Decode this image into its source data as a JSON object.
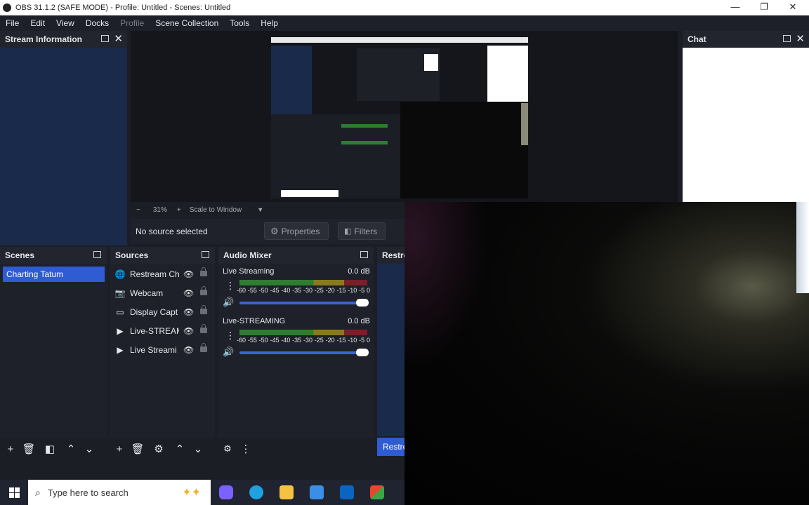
{
  "window": {
    "title": "OBS 31.1.2 (SAFE MODE) - Profile: Untitled - Scenes: Untitled",
    "controls": [
      "—",
      "❐",
      "✕"
    ]
  },
  "menu": [
    "File",
    "Edit",
    "View",
    "Docks",
    "Profile",
    "Scene Collection",
    "Tools",
    "Help"
  ],
  "docks": {
    "stream_information": "Stream Information",
    "chat": "Chat",
    "scenes": "Scenes",
    "sources": "Sources",
    "audio_mixer": "Audio Mixer",
    "restream": "Restre"
  },
  "preview": {
    "zoom": "31%",
    "scale_mode": "Scale to Window",
    "no_source": "No source selected",
    "properties": "Properties",
    "filters": "Filters"
  },
  "scenes": [
    "Charting Tatum"
  ],
  "sources": [
    {
      "name": "Restream Ch",
      "icon": "globe-icon"
    },
    {
      "name": "Webcam",
      "icon": "camera-icon"
    },
    {
      "name": "Display Capt",
      "icon": "monitor-icon"
    },
    {
      "name": "Live-STREAM",
      "icon": "play-icon"
    },
    {
      "name": "Live Streami",
      "icon": "play-icon"
    }
  ],
  "mixer": [
    {
      "name": "Live Streaming",
      "db": "0.0 dB",
      "volume": 1.0
    },
    {
      "name": "Live-STREAMING",
      "db": "0.0 dB",
      "volume": 1.0
    }
  ],
  "meter_scale": [
    "-60",
    "-55",
    "-50",
    "-45",
    "-40",
    "-35",
    "-30",
    "-25",
    "-20",
    "-15",
    "-10",
    "-5",
    "0"
  ],
  "restream_button": "Restre",
  "taskbar": {
    "search_placeholder": "Type here to search",
    "apps": [
      {
        "name": "copilot-icon",
        "color": "#7b61ff"
      },
      {
        "name": "edge-icon",
        "color": "#1fa0e0"
      },
      {
        "name": "file-explorer-icon",
        "color": "#f5c242"
      },
      {
        "name": "store-icon",
        "color": "#3a8ee6"
      },
      {
        "name": "outlook-icon",
        "color": "#0a64c2"
      },
      {
        "name": "office-icon",
        "color": "#e8452c"
      }
    ]
  },
  "colors": {
    "accent": "#2f5bd3",
    "dock_bg": "#1c1e26",
    "panel_blue": "#1a2a4a"
  }
}
